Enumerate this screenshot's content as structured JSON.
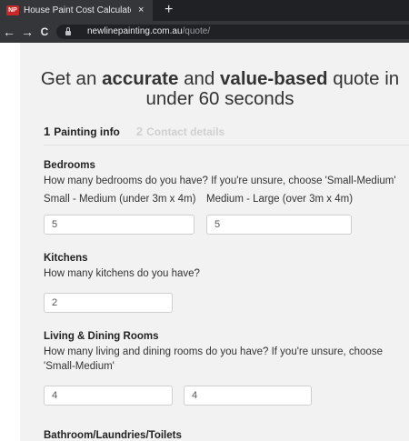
{
  "browser": {
    "tab_title": "House Paint Cost Calculator | Inst",
    "favicon_text": "NP",
    "close_symbol": "×",
    "new_tab_symbol": "+",
    "url_domain": "newlinepainting.com.au",
    "url_path": "/quote/",
    "back_symbol": "←",
    "forward_symbol": "→",
    "reload_symbol": "C"
  },
  "headline": {
    "part1": "Get an ",
    "bold1": "accurate",
    "part2": " and ",
    "bold2": "value-based",
    "part3": " quote in",
    "line2": "under 60 seconds"
  },
  "steps": [
    {
      "num": "1",
      "label": "Painting info"
    },
    {
      "num": "2",
      "label": "Contact details"
    }
  ],
  "bedrooms": {
    "title": "Bedrooms",
    "desc": "How many bedrooms do you have? If you're unsure, choose 'Small-Medium'",
    "label_small": "Small - Medium (under 3m x 4m)",
    "label_large": "Medium - Large (over 3m x 4m)",
    "value_small": "5",
    "value_large": "5"
  },
  "kitchens": {
    "title": "Kitchens",
    "desc": "How many kitchens do you have?",
    "value": "2"
  },
  "living": {
    "title": "Living & Dining Rooms",
    "desc": "How many living and dining rooms do you have? If you're unsure, choose 'Small-Medium'",
    "value_small": "4",
    "value_large": "4"
  },
  "bathrooms": {
    "title": "Bathroom/Laundries/Toilets"
  }
}
